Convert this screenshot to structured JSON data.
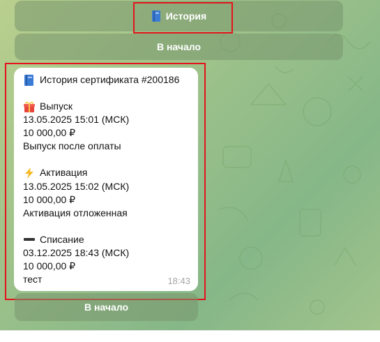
{
  "keyboard_top": {
    "history_button": {
      "label": "История",
      "icon": "book-icon"
    },
    "start_button": {
      "label": "В начало"
    }
  },
  "message": {
    "title": "История сертификата #200186",
    "title_icon": "book-icon",
    "events": [
      {
        "icon": "gift-icon",
        "name": "Выпуск",
        "datetime": "13.05.2025 15:01 (МСК)",
        "amount": "10 000,00 ₽",
        "note": "Выпуск после оплаты"
      },
      {
        "icon": "lightning-icon",
        "name": "Активация",
        "datetime": "13.05.2025 15:02 (МСК)",
        "amount": "10 000,00 ₽",
        "note": "Активация отложенная"
      },
      {
        "icon": "minus-icon",
        "name": "Списание",
        "datetime": "03.12.2025 18:43 (МСК)",
        "amount": "10 000,00 ₽",
        "note": "тест"
      }
    ],
    "time": "18:43"
  },
  "keyboard_bottom": {
    "start_button": {
      "label": "В начало"
    }
  },
  "colors": {
    "highlight": "#e2141c",
    "book": "#3a7bd5",
    "gift": "#e8453c",
    "lightning": "#f7b928"
  }
}
